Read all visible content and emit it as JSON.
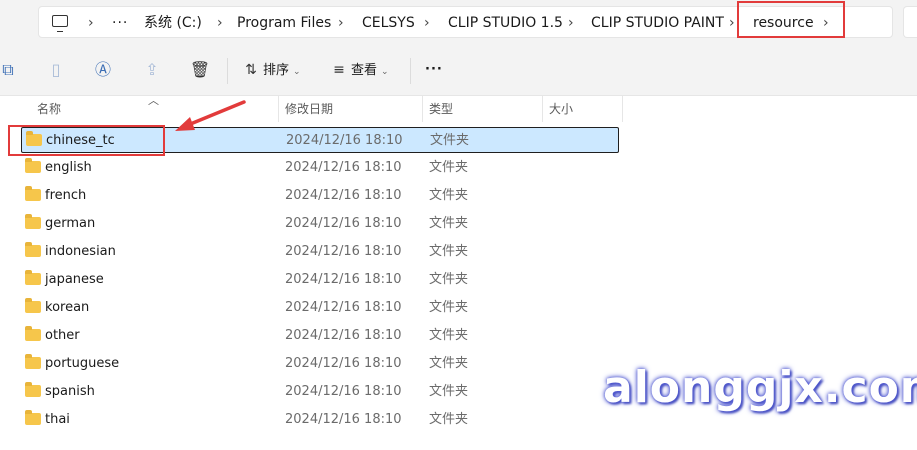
{
  "address_bar": {
    "more": "···",
    "crumbs": [
      "系统 (C:)",
      "Program Files",
      "CELSYS",
      "CLIP STUDIO 1.5",
      "CLIP STUDIO PAINT",
      "resource"
    ],
    "separator": "›"
  },
  "command_bar": {
    "sort_label": "排序",
    "view_label": "查看",
    "more": "···"
  },
  "columns": {
    "name": "名称",
    "modified": "修改日期",
    "type": "类型",
    "size": "大小"
  },
  "files": [
    {
      "name": "chinese_tc",
      "modified": "2024/12/16 18:10",
      "type": "文件夹",
      "selected": true
    },
    {
      "name": "english",
      "modified": "2024/12/16 18:10",
      "type": "文件夹"
    },
    {
      "name": "french",
      "modified": "2024/12/16 18:10",
      "type": "文件夹"
    },
    {
      "name": "german",
      "modified": "2024/12/16 18:10",
      "type": "文件夹"
    },
    {
      "name": "indonesian",
      "modified": "2024/12/16 18:10",
      "type": "文件夹"
    },
    {
      "name": "japanese",
      "modified": "2024/12/16 18:10",
      "type": "文件夹"
    },
    {
      "name": "korean",
      "modified": "2024/12/16 18:10",
      "type": "文件夹"
    },
    {
      "name": "other",
      "modified": "2024/12/16 18:10",
      "type": "文件夹"
    },
    {
      "name": "portuguese",
      "modified": "2024/12/16 18:10",
      "type": "文件夹"
    },
    {
      "name": "spanish",
      "modified": "2024/12/16 18:10",
      "type": "文件夹"
    },
    {
      "name": "thai",
      "modified": "2024/12/16 18:10",
      "type": "文件夹"
    }
  ],
  "watermark": "alonggjx.com",
  "colors": {
    "selection": "#cce8ff",
    "annotation_red": "#e23b3b",
    "folder": "#f6c64b"
  }
}
